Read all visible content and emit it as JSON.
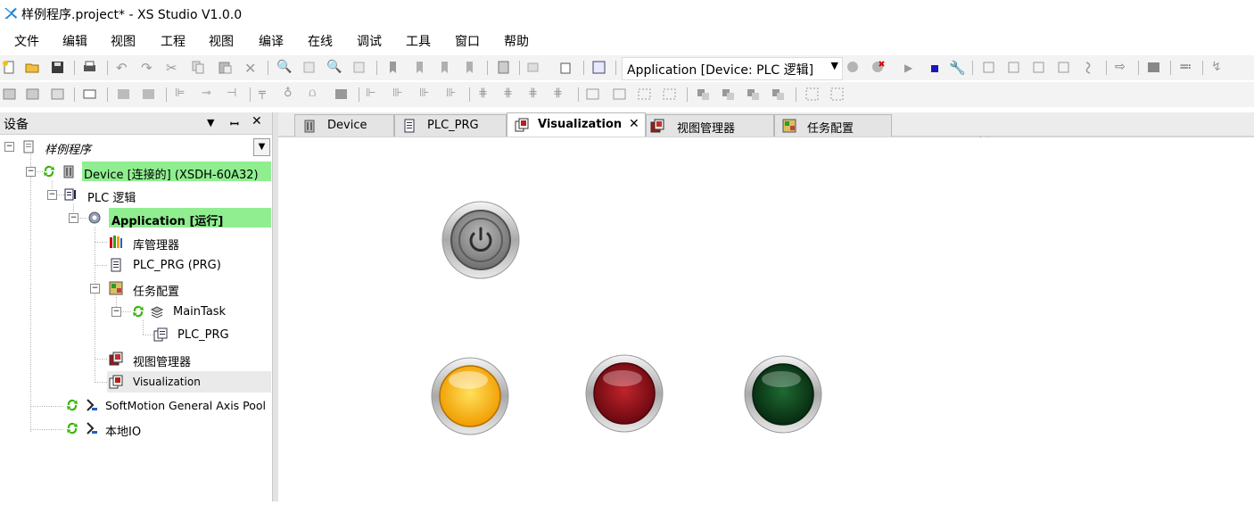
{
  "window": {
    "title": "样例程序.project* - XS Studio V1.0.0"
  },
  "menu": [
    "文件",
    "编辑",
    "视图",
    "工程",
    "视图",
    "编译",
    "在线",
    "调试",
    "工具",
    "窗口",
    "帮助"
  ],
  "toolbar": {
    "application_combo": "Application [Device: PLC 逻辑]"
  },
  "panel": {
    "title": "设备",
    "pin": "▾",
    "dock": "ꟷ",
    "close": "✕"
  },
  "tree": {
    "root": "样例程序",
    "device": "Device [连接的] (XSDH-60A32)",
    "plc_logic": "PLC 逻辑",
    "application": "Application [运行]",
    "library": "库管理器",
    "plc_prg": "PLC_PRG (PRG)",
    "task_config": "任务配置",
    "main_task": "MainTask",
    "main_task_prg": "PLC_PRG",
    "visu_manager": "视图管理器",
    "visualization": "Visualization",
    "softmotion": "SoftMotion General Axis Pool",
    "local_io": "本地IO"
  },
  "tabs": [
    {
      "label": "Device",
      "active": false
    },
    {
      "label": "PLC_PRG",
      "active": false
    },
    {
      "label": "Visualization",
      "active": true
    },
    {
      "label": "视图管理器",
      "active": false
    },
    {
      "label": "任务配置",
      "active": false
    }
  ],
  "colors": {
    "online_highlight": "#90ee90",
    "lamp_yellow": "#ffc21a",
    "lamp_red": "#9b0f18",
    "lamp_green": "#0f4a1f"
  },
  "icons": {
    "power_button": "power-icon",
    "lamps": [
      "yellow-lamp",
      "red-lamp",
      "green-lamp"
    ]
  }
}
